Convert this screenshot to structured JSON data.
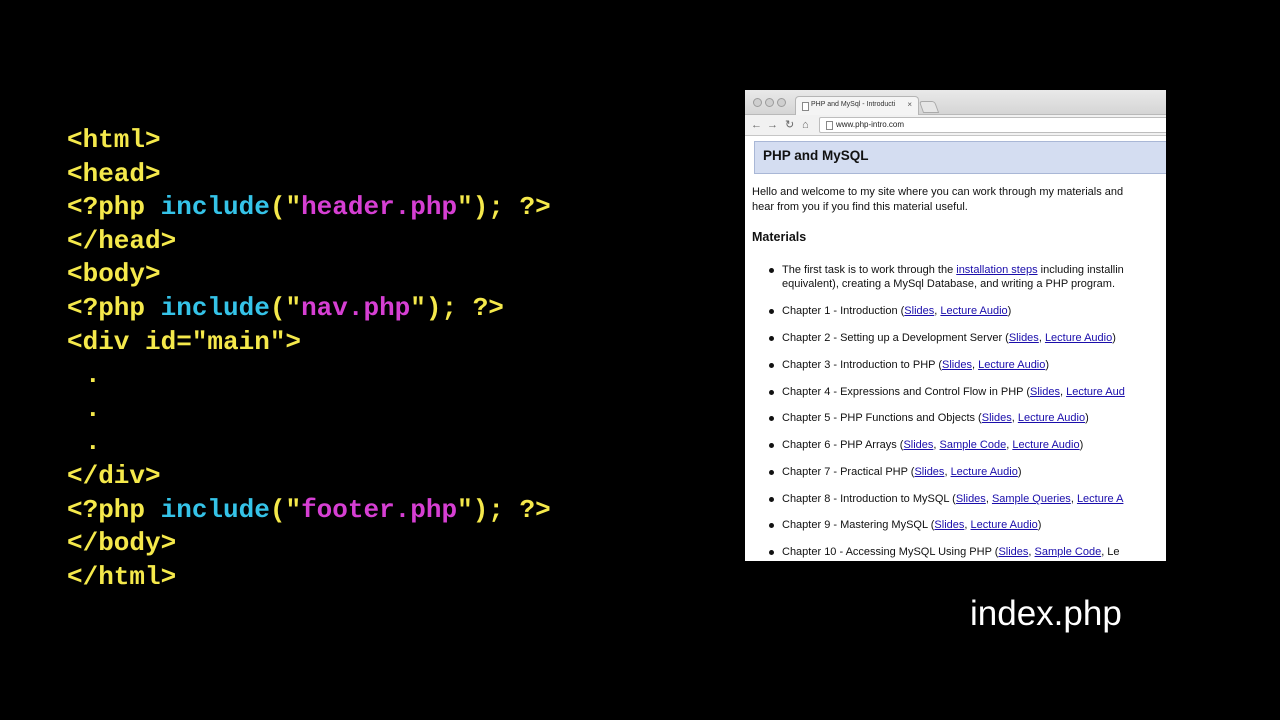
{
  "code": {
    "lines": [
      [
        {
          "t": "<html>",
          "c": "tag"
        }
      ],
      [
        {
          "t": "<head>",
          "c": "tag"
        }
      ],
      [
        {
          "t": "<?php ",
          "c": "tag"
        },
        {
          "t": "include",
          "c": "fn"
        },
        {
          "t": "(\"",
          "c": "tag"
        },
        {
          "t": "header.php",
          "c": "str"
        },
        {
          "t": "\"); ?>",
          "c": "tag"
        }
      ],
      [
        {
          "t": "</head>",
          "c": "tag"
        }
      ],
      [
        {
          "t": "<body>",
          "c": "tag"
        }
      ],
      [
        {
          "t": "<?php ",
          "c": "tag"
        },
        {
          "t": "include",
          "c": "fn"
        },
        {
          "t": "(\"",
          "c": "tag"
        },
        {
          "t": "nav.php",
          "c": "str"
        },
        {
          "t": "\"); ?>",
          "c": "tag"
        }
      ],
      [
        {
          "t": "<div id=\"main\">",
          "c": "tag"
        }
      ],
      [
        {
          "t": ".",
          "c": "dot"
        }
      ],
      [
        {
          "t": ".",
          "c": "dot"
        }
      ],
      [
        {
          "t": ".",
          "c": "dot"
        }
      ],
      [
        {
          "t": "</div>",
          "c": "tag"
        }
      ],
      [
        {
          "t": "<?php ",
          "c": "tag"
        },
        {
          "t": "include",
          "c": "fn"
        },
        {
          "t": "(\"",
          "c": "tag"
        },
        {
          "t": "footer.php",
          "c": "str"
        },
        {
          "t": "\"); ?>",
          "c": "tag"
        }
      ],
      [
        {
          "t": "</body>",
          "c": "tag"
        }
      ],
      [
        {
          "t": "</html>",
          "c": "tag"
        }
      ]
    ]
  },
  "browser": {
    "tab_title": "PHP and MySql - Introducti",
    "tab_close": "×",
    "nav": {
      "back": "←",
      "forward": "→",
      "reload": "↻",
      "home": "⌂"
    },
    "url": "www.php-intro.com",
    "site_title": "PHP and MySQL",
    "intro": "Hello and welcome to my site where you can work through my materials and\nhear from you if you find this material useful.",
    "materials_heading": "Materials",
    "items": [
      [
        [
          "The first task is to work through the ",
          false
        ],
        [
          "installation steps",
          true
        ],
        [
          " including installin",
          false
        ]
      ],
      [
        [
          "equivalent), creating a MySql Database, and writing a PHP program.",
          false
        ]
      ],
      [
        [
          "Chapter 1 - Introduction (",
          false
        ],
        [
          "Slides",
          true
        ],
        [
          ", ",
          false
        ],
        [
          "Lecture Audio",
          true
        ],
        [
          ")",
          false
        ]
      ],
      [
        [
          "Chapter 2 - Setting up a Development Server (",
          false
        ],
        [
          "Slides",
          true
        ],
        [
          ", ",
          false
        ],
        [
          "Lecture Audio",
          true
        ],
        [
          ")",
          false
        ]
      ],
      [
        [
          "Chapter 3 - Introduction to PHP (",
          false
        ],
        [
          "Slides",
          true
        ],
        [
          ", ",
          false
        ],
        [
          "Lecture Audio",
          true
        ],
        [
          ")",
          false
        ]
      ],
      [
        [
          "Chapter 4 - Expressions and Control Flow in PHP (",
          false
        ],
        [
          "Slides",
          true
        ],
        [
          ", ",
          false
        ],
        [
          "Lecture Aud",
          true
        ]
      ],
      [
        [
          "Chapter 5 - PHP Functions and Objects (",
          false
        ],
        [
          "Slides",
          true
        ],
        [
          ", ",
          false
        ],
        [
          "Lecture Audio",
          true
        ],
        [
          ")",
          false
        ]
      ],
      [
        [
          "Chapter 6 - PHP Arrays (",
          false
        ],
        [
          "Slides",
          true
        ],
        [
          ", ",
          false
        ],
        [
          "Sample Code",
          true
        ],
        [
          ", ",
          false
        ],
        [
          "Lecture Audio",
          true
        ],
        [
          ")",
          false
        ]
      ],
      [
        [
          "Chapter 7 - Practical PHP (",
          false
        ],
        [
          "Slides",
          true
        ],
        [
          ", ",
          false
        ],
        [
          "Lecture Audio",
          true
        ],
        [
          ")",
          false
        ]
      ],
      [
        [
          "Chapter 8 - Introduction to MySQL (",
          false
        ],
        [
          "Slides",
          true
        ],
        [
          ", ",
          false
        ],
        [
          "Sample Queries",
          true
        ],
        [
          ", ",
          false
        ],
        [
          "Lecture A",
          true
        ]
      ],
      [
        [
          "Chapter 9 - Mastering MySQL (",
          false
        ],
        [
          "Slides",
          true
        ],
        [
          ", ",
          false
        ],
        [
          "Lecture Audio",
          true
        ],
        [
          ")",
          false
        ]
      ],
      [
        [
          "Chapter 10 - Accessing MySQL Using PHP (",
          false
        ],
        [
          "Slides",
          true
        ],
        [
          ", ",
          false
        ],
        [
          "Sample Code",
          true
        ],
        [
          ", Le",
          false
        ]
      ]
    ]
  },
  "caption": "index.php"
}
